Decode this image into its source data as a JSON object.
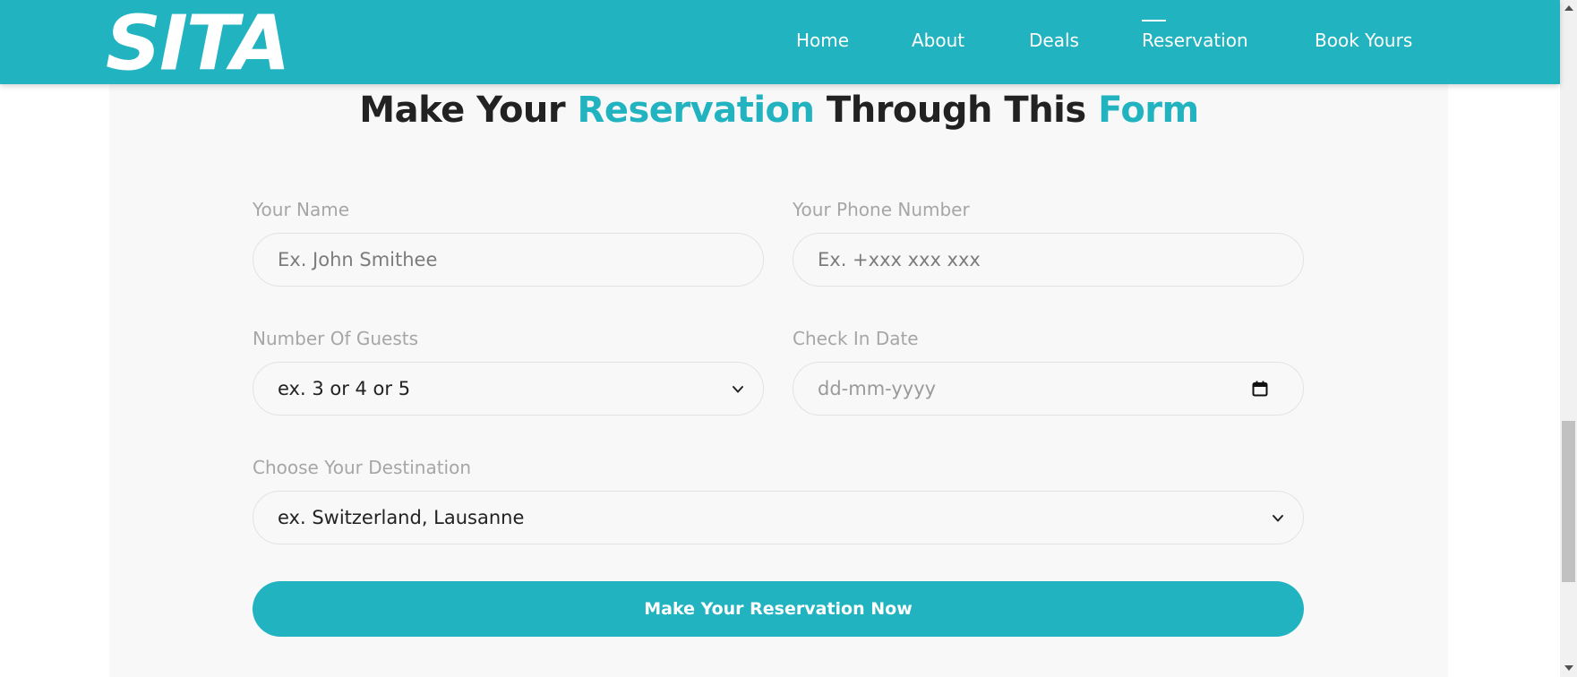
{
  "brand": {
    "logo": "SITA",
    "accent_color": "#22b3c1"
  },
  "nav": {
    "items": [
      {
        "label": "Home"
      },
      {
        "label": "About"
      },
      {
        "label": "Deals"
      },
      {
        "label": "Reservation",
        "active": true
      },
      {
        "label": "Book Yours"
      }
    ]
  },
  "heading": {
    "part1": "Make Your ",
    "part2": "Reservation",
    "part3": " Through This ",
    "part4": "Form"
  },
  "form": {
    "name": {
      "label": "Your Name",
      "placeholder": "Ex. John Smithee"
    },
    "phone": {
      "label": "Your Phone Number",
      "placeholder": "Ex. +xxx xxx xxx"
    },
    "guests": {
      "label": "Number Of Guests",
      "selected": "ex. 3 or 4 or 5"
    },
    "checkin": {
      "label": "Check In Date",
      "placeholder": "dd-mm-yyyy"
    },
    "destination": {
      "label": "Choose Your Destination",
      "selected": "ex. Switzerland, Lausanne"
    },
    "submit_label": "Make Your Reservation Now"
  },
  "icons": {
    "dropdown": "chevron-down-icon",
    "date": "calendar-icon"
  }
}
